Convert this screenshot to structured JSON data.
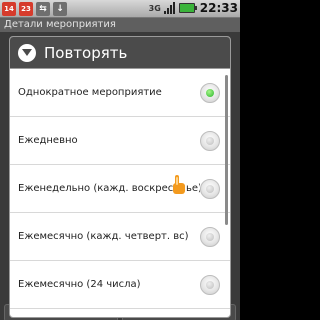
{
  "status_bar": {
    "badges": [
      "14",
      "23"
    ],
    "network": "3G",
    "time": "22:33"
  },
  "background": {
    "title": "Детали мероприятия"
  },
  "dialog": {
    "title": "Повторять",
    "options": [
      {
        "label": "Однократное мероприятие",
        "checked": true
      },
      {
        "label": "Ежедневно",
        "checked": false
      },
      {
        "label": "Еженедельно (кажд. воскресенье)",
        "checked": false
      },
      {
        "label": "Ежемесячно (кажд. четверт. вс)",
        "checked": false
      },
      {
        "label": "Ежемесячно (24 числа)",
        "checked": false
      }
    ]
  },
  "colors": {
    "checked": "#29b52a",
    "header_bg": "#4b4b4b",
    "touch_indicator": "#f39a1e"
  }
}
